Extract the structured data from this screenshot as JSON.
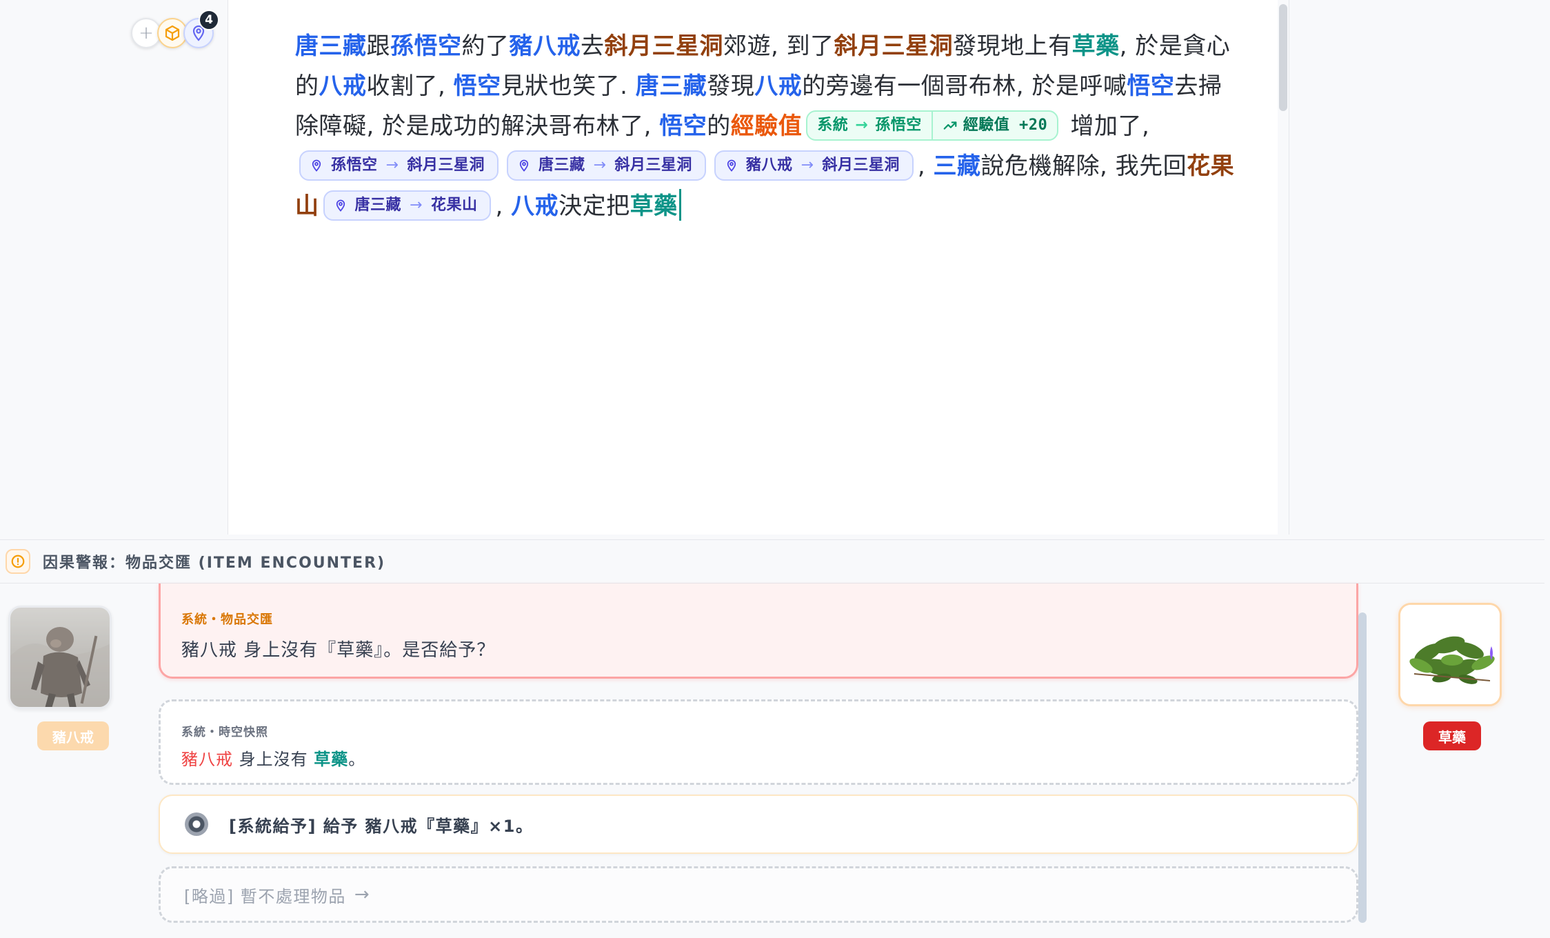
{
  "toolbar": {
    "plus_label": "+",
    "badge_count": "4"
  },
  "editor": {
    "s": [
      "唐三藏",
      "跟",
      "孫悟空",
      "約了",
      "豬八戒",
      "去",
      "斜月三星洞",
      "郊遊, 到了",
      "斜月三星洞",
      "發現地上有",
      "草藥",
      ", 於是貪心的",
      "八戒",
      "收割了, ",
      "悟空",
      "見狀也笑了. ",
      "唐三藏",
      "發現",
      "八戒",
      "的旁邊有一個哥布林, 於是呼喊",
      "悟空",
      "去掃除障礙, 於是成功的解決哥布林了, ",
      "悟空",
      "的",
      "經驗值",
      "增加了,",
      ", ",
      "三藏",
      "說危機解除, 我先回",
      "花果山",
      ", ",
      "八戒",
      "決定把",
      "草藥"
    ],
    "xp_chip": {
      "from": "系統",
      "to": "孫悟空",
      "stat": "經驗值 +20"
    },
    "move_chips": [
      {
        "who": "孫悟空",
        "where": "斜月三星洞"
      },
      {
        "who": "唐三藏",
        "where": "斜月三星洞"
      },
      {
        "who": "豬八戒",
        "where": "斜月三星洞"
      },
      {
        "who": "唐三藏",
        "where": "花果山"
      }
    ],
    "arrow": "→"
  },
  "alert": {
    "title": "因果警報：物品交匯 (ITEM ENCOUNTER)"
  },
  "encounter": {
    "left_tag": "豬八戒",
    "right_tag": "草藥",
    "system_label": "系統・物品交匯",
    "system_msg": "豬八戒 身上沒有『草藥』。是否給予？",
    "snapshot_label": "系統・時空快照",
    "snapshot_who": "豬八戒",
    "snapshot_mid": " 身上沒有 ",
    "snapshot_what": "草藥",
    "snapshot_end": "。",
    "give_option": "[系統給予] 給予 豬八戒『草藥』×1。",
    "skip_option": "[略過] 暫不處理物品",
    "skip_arrow": "→"
  },
  "colors": {
    "character": "#2563eb",
    "place": "#92400e",
    "item": "#0d9488",
    "stat": "#ea580c",
    "alert_border": "#fca5a5",
    "tag_red": "#dc2626"
  },
  "icons": [
    "plus-icon",
    "box-icon",
    "map-pin-icon",
    "trending-up-icon",
    "alert-circle-icon",
    "arrow-right-icon"
  ]
}
